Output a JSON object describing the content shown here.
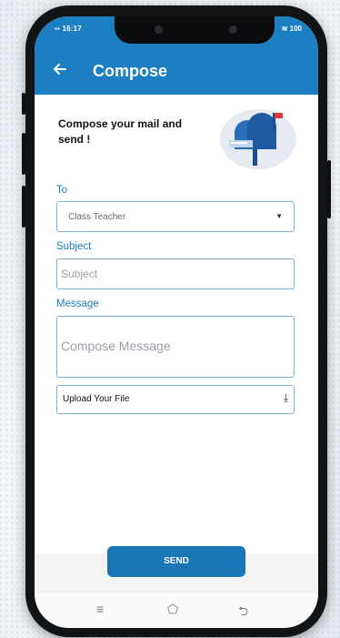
{
  "status_bar": {
    "time": "16:17",
    "right": "100"
  },
  "header": {
    "back_icon": "arrow-left-icon",
    "title": "Compose"
  },
  "content": {
    "heading": "Compose your mail and send !",
    "illustration": "mailbox-icon"
  },
  "form": {
    "to_label": "To",
    "to_value": "Class Teacher",
    "subject_label": "Subject",
    "subject_placeholder": "Subject",
    "message_label": "Message",
    "message_placeholder": "Compose Message",
    "upload_label": "Upload Your File"
  },
  "actions": {
    "send_label": "SEND"
  },
  "colors": {
    "primary": "#1c7fc2",
    "button": "#1a76b6"
  }
}
